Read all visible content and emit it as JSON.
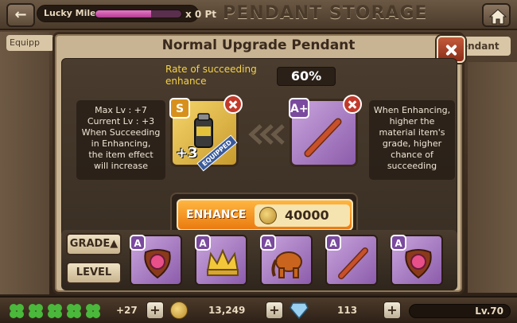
{
  "topbar": {
    "back_icon": "←",
    "mileage_label": "Lucky Mileage",
    "mileage_fraction": 0.65,
    "mileage_points": "x 0 Pt",
    "title": "PENDANT STORAGE"
  },
  "side": {
    "left_tab": "Equipp",
    "right_tab": "endant"
  },
  "modal": {
    "title": "Normal Upgrade Pendant",
    "rate_label": "Rate of succeeding enhance",
    "rate_value": "60%",
    "info_left": [
      "Max Lv : +7",
      "Current Lv : +3",
      "When Succeeding",
      "in Enhancing,",
      "the item effect",
      "will increase"
    ],
    "info_right": [
      "When Enhancing,",
      "higher the",
      "material item's",
      "grade, higher",
      "chance of",
      "succeeding"
    ],
    "main_item": {
      "grade": "S",
      "level": "+3",
      "tag": "EQUIPPED"
    },
    "material_item": {
      "grade": "A+"
    },
    "enhance_label": "ENHANCE",
    "enhance_cost": "40000",
    "sort_buttons": {
      "grade": "GRADE▲",
      "level": "LEVEL"
    },
    "inventory": [
      {
        "grade": "A",
        "icon": "gem-pendant-icon"
      },
      {
        "grade": "A",
        "icon": "crown-icon"
      },
      {
        "grade": "A",
        "icon": "elephant-icon"
      },
      {
        "grade": "A",
        "icon": "bat-icon"
      },
      {
        "grade": "A",
        "icon": "gem-pendant-icon"
      }
    ]
  },
  "bottombar": {
    "clover_extra": "+27",
    "coins": "13,249",
    "gems": "113",
    "level": "Lv.70"
  },
  "colors": {
    "accent_orange": "#ea7a10",
    "rate_yellow": "#f5d24a",
    "grade_s": "#d8901c",
    "grade_a": "#7a4a9e",
    "close_red": "#c45a3a"
  }
}
